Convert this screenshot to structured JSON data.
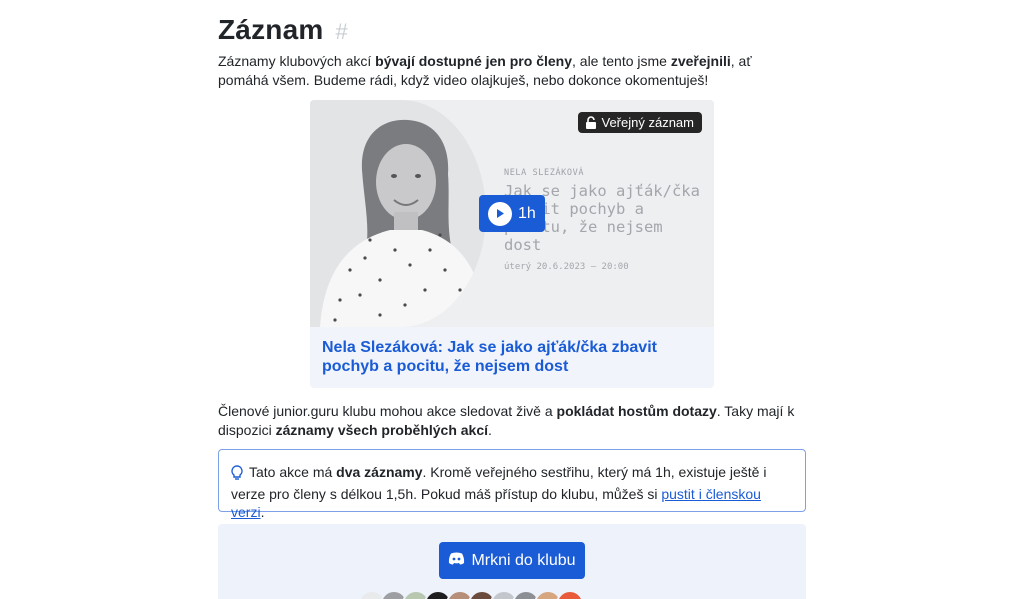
{
  "section": {
    "title": "Záznam",
    "anchor": "#"
  },
  "intro": {
    "t1": "Záznamy klubových akcí ",
    "b1": "bývají dostupné jen pro členy",
    "t2": ", ale tento jsme ",
    "b2": "zveřejnili",
    "t3": ", ať pomáhá všem. Budeme rádi, když video olajkuješ, nebo dokonce okomentuješ!"
  },
  "video": {
    "badge": "Veřejný záznam",
    "speaker": "NELA SLEZÁKOVÁ",
    "thumb_title": "Jak se jako ajťák/čka zbavit pochyb a pocitu, že nejsem dost",
    "date": "úterý 20.6.2023 — 20:00",
    "duration": "1h",
    "title": "Nela Slezáková: Jak se jako ajťák/čka zbavit pochyb a pocitu, že nejsem dost"
  },
  "members": {
    "t1": "Členové junior.guru klubu mohou akce sledovat živě a ",
    "b1": "pokládat hostům dotazy",
    "t2": ". Taky mají k dispozici ",
    "b2": "záznamy všech proběhlých akcí",
    "t3": "."
  },
  "note": {
    "t1": "Tato akce má ",
    "b1": "dva záznamy",
    "t2": ". Kromě veřejného sestřihu, který má 1h, existuje ještě i verze pro členy s délkou 1,5h. Pokud máš přístup do klubu, můžeš si ",
    "link": "pustit i členskou verzi",
    "t3": "."
  },
  "club": {
    "button_label": "Mrkni do klubu"
  },
  "colors": {
    "accent": "#1a5bd6",
    "badge_bg": "#262626",
    "card_bg": "#f1f4fa"
  },
  "icons": [
    "unlock-icon",
    "play-icon",
    "lightbulb-icon",
    "discord-icon"
  ]
}
